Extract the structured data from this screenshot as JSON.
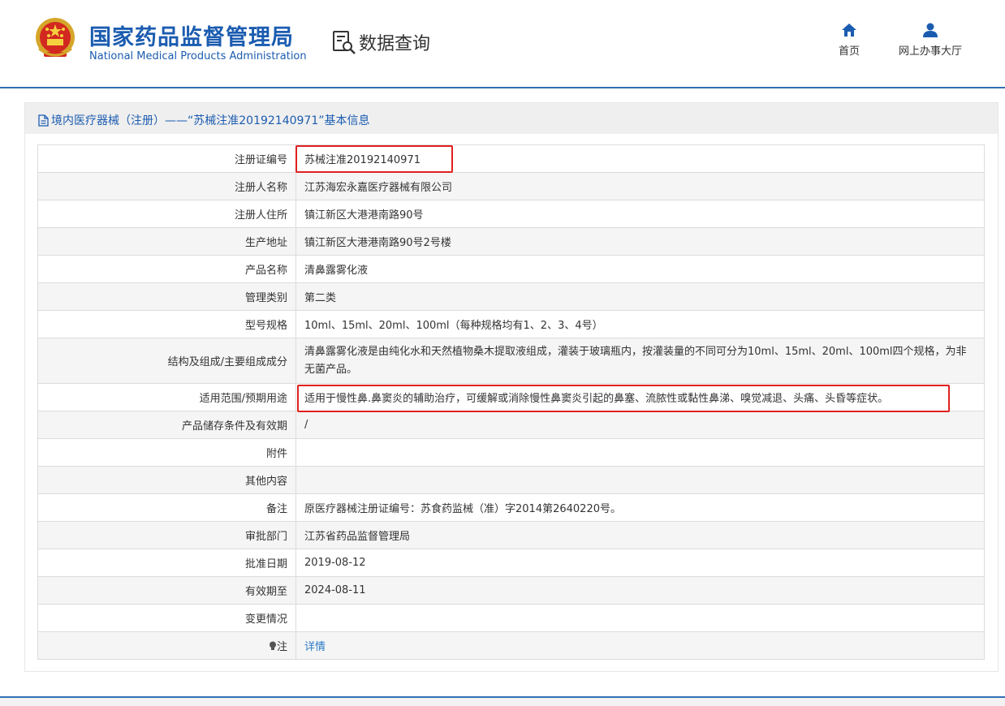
{
  "header": {
    "brand_cn": "国家药品监督管理局",
    "brand_en": "National Medical Products Administration",
    "query_title": "数据查询",
    "nav": {
      "home": "首页",
      "online_service": "网上办事大厅"
    }
  },
  "panel": {
    "title": "境内医疗器械（注册）——“苏械注准20192140971”基本信息"
  },
  "rows": [
    {
      "label": "注册证编号",
      "value": "苏械注准20192140971"
    },
    {
      "label": "注册人名称",
      "value": "江苏海宏永嘉医疗器械有限公司"
    },
    {
      "label": "注册人住所",
      "value": "镇江新区大港港南路90号"
    },
    {
      "label": "生产地址",
      "value": "镇江新区大港港南路90号2号楼"
    },
    {
      "label": "产品名称",
      "value": "清鼻露雾化液"
    },
    {
      "label": "管理类别",
      "value": "第二类"
    },
    {
      "label": "型号规格",
      "value": "10ml、15ml、20ml、100ml（每种规格均有1、2、3、4号）"
    },
    {
      "label": "结构及组成/主要组成成分",
      "value": "清鼻露雾化液是由纯化水和天然植物桑木提取液组成，灌装于玻璃瓶内，按灌装量的不同可分为10ml、15ml、20ml、100ml四个规格，为非无菌产品。"
    },
    {
      "label": "适用范围/预期用途",
      "value": "适用于慢性鼻.鼻窦炎的辅助治疗，可缓解或消除慢性鼻窦炎引起的鼻塞、流脓性或黏性鼻涕、嗅觉减退、头痛、头昏等症状。"
    },
    {
      "label": "产品储存条件及有效期",
      "value": "/"
    },
    {
      "label": "附件",
      "value": ""
    },
    {
      "label": "其他内容",
      "value": ""
    },
    {
      "label": "备注",
      "value": "原医疗器械注册证编号：苏食药监械（准）字2014第2640220号。"
    },
    {
      "label": "审批部门",
      "value": "江苏省药品监督管理局"
    },
    {
      "label": "批准日期",
      "value": "2019-08-12"
    },
    {
      "label": "有效期至",
      "value": "2024-08-11"
    },
    {
      "label": "变更情况",
      "value": ""
    },
    {
      "label": "注",
      "value": "详情"
    }
  ],
  "colors": {
    "brand_blue": "#1b5cb0",
    "link_blue": "#2a7ac7",
    "highlight_red": "#e02020"
  },
  "icons": [
    "national-emblem-icon",
    "data-query-icon",
    "home-icon",
    "user-icon",
    "document-icon",
    "bulb-icon"
  ]
}
